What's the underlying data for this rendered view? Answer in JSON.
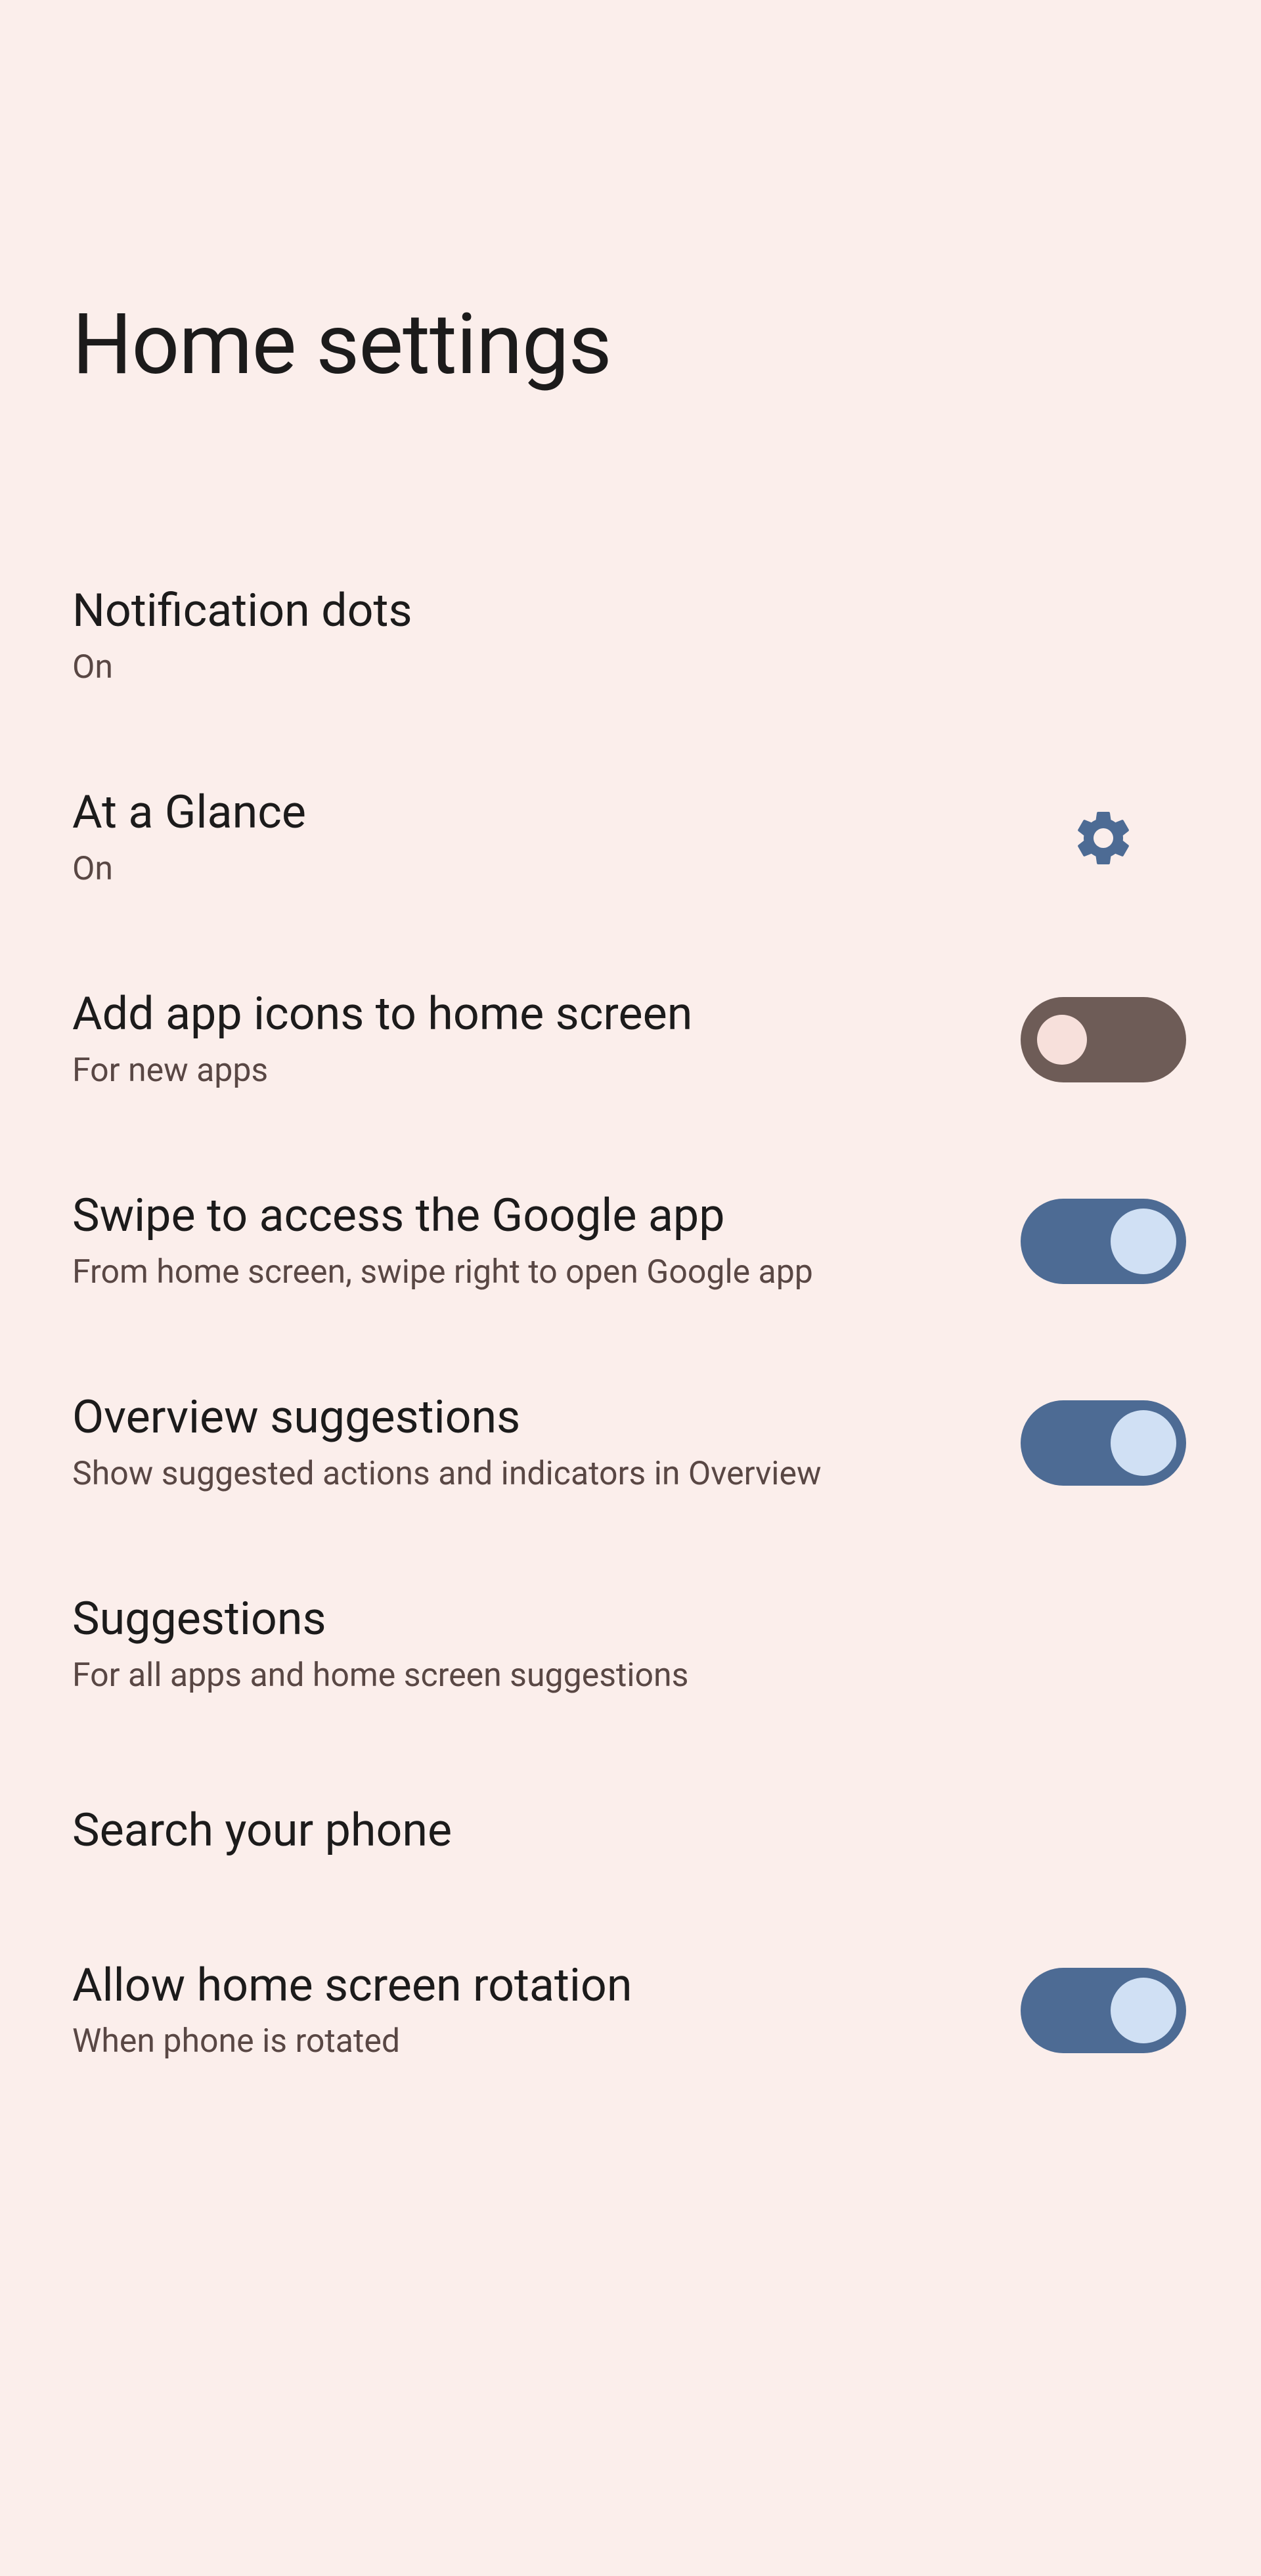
{
  "header": {
    "title": "Home settings"
  },
  "settings": {
    "notification_dots": {
      "title": "Notification dots",
      "sub": "On"
    },
    "at_a_glance": {
      "title": "At a Glance",
      "sub": "On"
    },
    "add_icons": {
      "title": "Add app icons to home screen",
      "sub": "For new apps",
      "on": false
    },
    "swipe_google": {
      "title": "Swipe to access the Google app",
      "sub": "From home screen, swipe right to open Google app",
      "on": true
    },
    "overview_sugg": {
      "title": "Overview suggestions",
      "sub": "Show suggested actions and indicators in Overview",
      "on": true
    },
    "suggestions": {
      "title": "Suggestions",
      "sub": "For all apps and home screen suggestions"
    },
    "search_phone": {
      "title": "Search your phone"
    },
    "rotation": {
      "title": "Allow home screen rotation",
      "sub": "When phone is rotated",
      "on": true
    }
  }
}
